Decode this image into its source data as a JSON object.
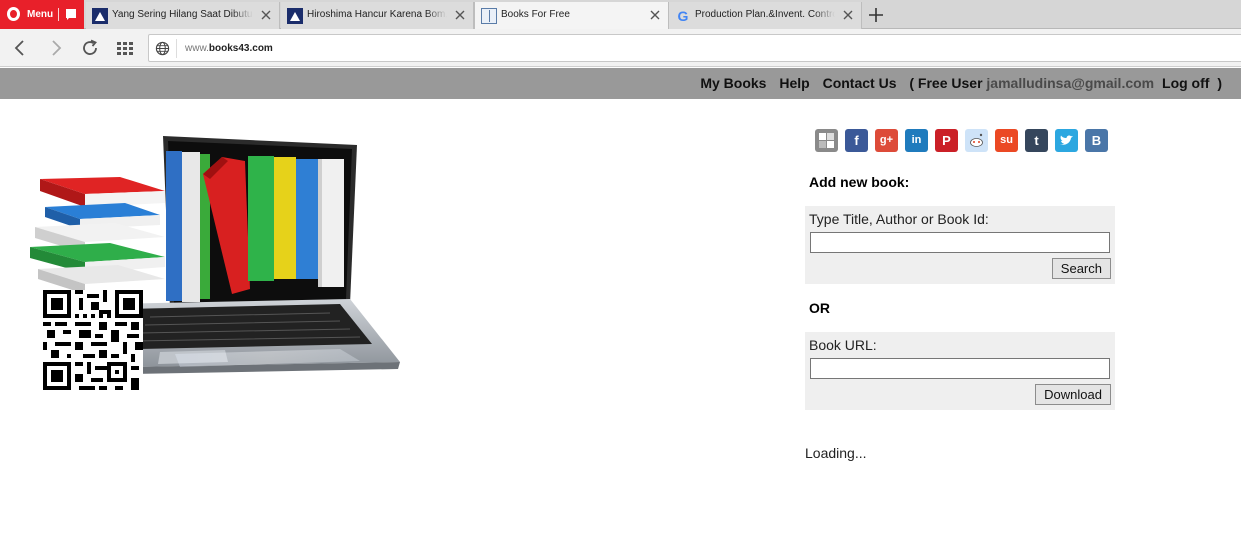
{
  "browser": {
    "menu_label": "Menu",
    "tabs": [
      {
        "title": "Yang Sering Hilang Saat Dibutuhkan",
        "favicon": "hiroshima-site-icon",
        "active": false
      },
      {
        "title": "Hiroshima Hancur Karena Bom, W",
        "favicon": "hiroshima-site-icon",
        "active": false
      },
      {
        "title": "Books For Free",
        "favicon": "book-icon",
        "active": true
      },
      {
        "title": "Production Plan.&Invent. Control",
        "favicon": "google-icon",
        "active": false
      }
    ],
    "url_prefix": "www.",
    "url_domain": "books43.com"
  },
  "header": {
    "my_books": "My Books",
    "help": "Help",
    "contact": "Contact Us",
    "user_open": "( Free User",
    "email": "jamalludinsa@gmail.com",
    "logoff": "Log off",
    "user_close": ")"
  },
  "share": {
    "icons": [
      "delicious-icon",
      "facebook-icon",
      "google-plus-icon",
      "linkedin-icon",
      "pinterest-icon",
      "reddit-icon",
      "stumbleupon-icon",
      "tumblr-icon",
      "twitter-icon",
      "vk-icon"
    ],
    "colors": {
      "delicious": "#8a8a8a",
      "facebook": "#3b5998",
      "google_plus": "#dd4b39",
      "linkedin": "#1f7bbd",
      "pinterest": "#cb2027",
      "reddit": "#cee3f8",
      "stumbleupon": "#eb4924",
      "tumblr": "#35465c",
      "twitter": "#2ca7e0",
      "vk": "#4a76a8"
    }
  },
  "add_book": {
    "heading": "Add new book:",
    "search_label": "Type Title, Author or Book Id:",
    "search_value": "",
    "search_button": "Search",
    "or_label": "OR",
    "url_label": "Book URL:",
    "url_value": "",
    "download_button": "Download"
  },
  "status": {
    "loading": "Loading..."
  }
}
